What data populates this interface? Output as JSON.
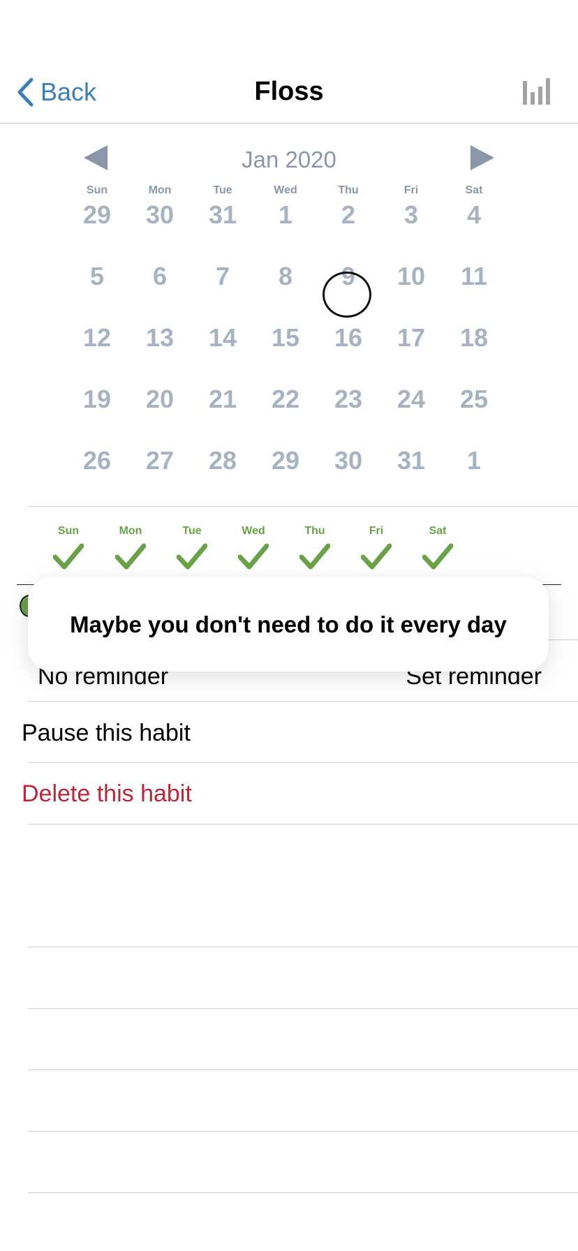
{
  "nav": {
    "back_label": "Back",
    "title": "Floss"
  },
  "calendar": {
    "month_label": "Jan 2020",
    "weekdays": [
      "Sun",
      "Mon",
      "Tue",
      "Wed",
      "Thu",
      "Fri",
      "Sat"
    ],
    "weeks": [
      [
        "29",
        "30",
        "31",
        "1",
        "2",
        "3",
        "4"
      ],
      [
        "5",
        "6",
        "7",
        "8",
        "9",
        "10",
        "11"
      ],
      [
        "12",
        "13",
        "14",
        "15",
        "16",
        "17",
        "18"
      ],
      [
        "19",
        "20",
        "21",
        "22",
        "23",
        "24",
        "25"
      ],
      [
        "26",
        "27",
        "28",
        "29",
        "30",
        "31",
        "1"
      ]
    ],
    "selected_day": "9"
  },
  "schedule": {
    "days": [
      "Sun",
      "Mon",
      "Tue",
      "Wed",
      "Thu",
      "Fri",
      "Sat"
    ],
    "all_checked": true,
    "accent_color": "#6aa24a"
  },
  "popover": {
    "text": "Maybe you don't need to do it every day"
  },
  "reminder": {
    "left_label": "No reminder",
    "right_label": "Set reminder"
  },
  "actions": {
    "pause_label": "Pause this habit",
    "delete_label": "Delete this habit",
    "delete_color": "#b7283a"
  }
}
